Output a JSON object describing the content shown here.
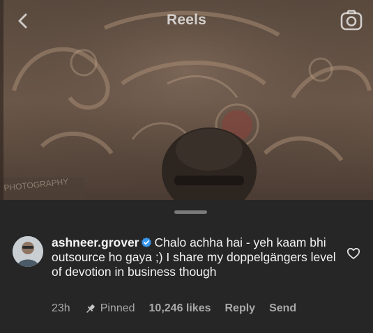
{
  "header": {
    "title": "Reels",
    "back_icon": "chevron-left-icon",
    "camera_icon": "camera-icon"
  },
  "comment": {
    "username": "ashneer.grover",
    "verified_icon": "verified-badge-icon",
    "text": "Chalo achha hai - yeh kaam bhi outsource ho gaya ;) I share my doppelgängers level of devotion in business though",
    "time": "23h",
    "pinned_label": "Pinned",
    "likes": "10,246 likes",
    "reply_label": "Reply",
    "send_label": "Send",
    "like_icon": "heart-outline-icon",
    "pin_icon": "pin-icon"
  },
  "colors": {
    "sheet_bg": "#262626",
    "text_primary": "#f2f2f2",
    "text_secondary": "#a8a8a8",
    "verified_blue": "#3897f0"
  }
}
